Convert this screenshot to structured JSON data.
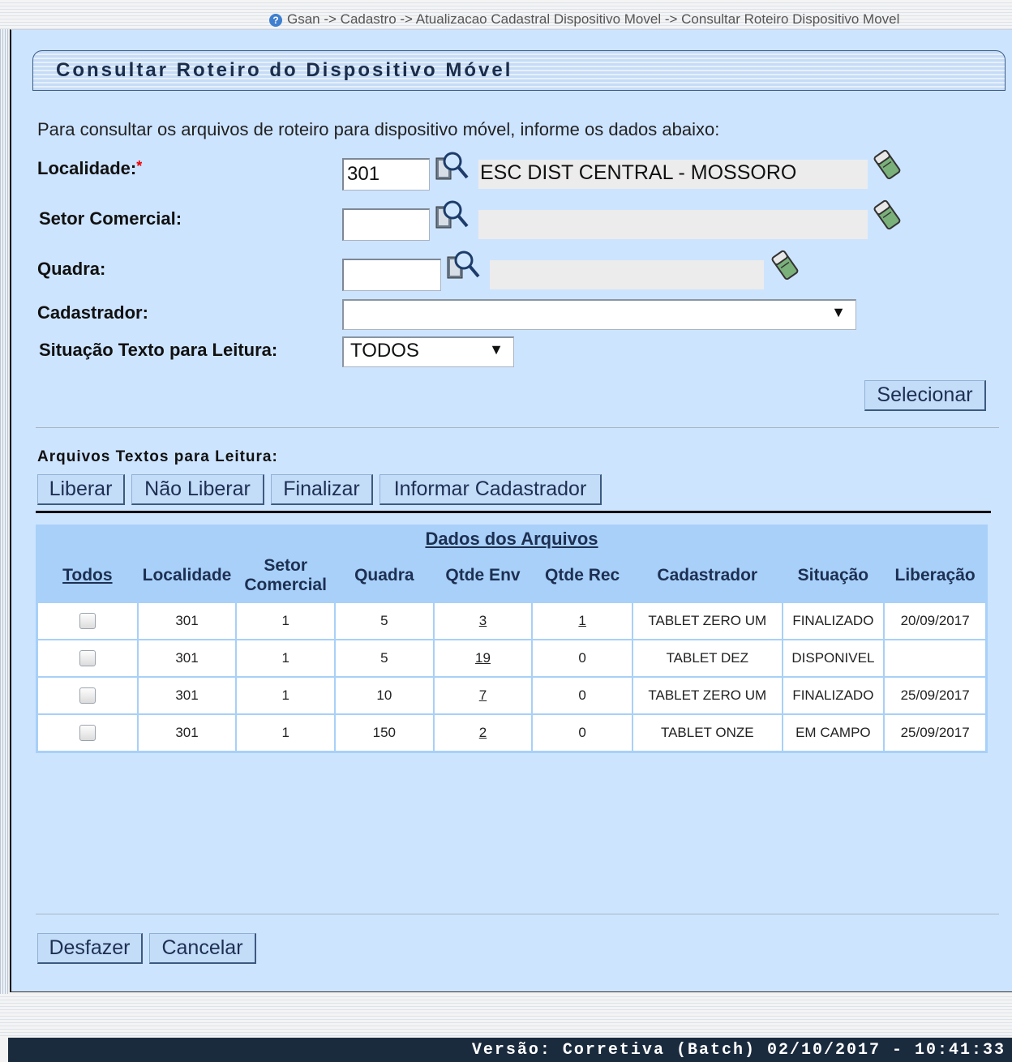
{
  "breadcrumb": "Gsan -> Cadastro -> Atualizacao Cadastral Dispositivo Movel -> Consultar Roteiro Dispositivo Movel",
  "page_title": "Consultar Roteiro do Dispositivo Móvel",
  "intro_text": "Para consultar os arquivos de roteiro para dispositivo móvel, informe os dados abaixo:",
  "form": {
    "localidade": {
      "label": "Localidade:",
      "required_mark": "*",
      "code": "301",
      "description": "ESC DIST CENTRAL - MOSSORO"
    },
    "setor_comercial": {
      "label": "Setor Comercial:",
      "code": "",
      "description": ""
    },
    "quadra": {
      "label": "Quadra:",
      "code": "",
      "description": ""
    },
    "cadastrador": {
      "label": "Cadastrador:",
      "selected": ""
    },
    "situacao": {
      "label": "Situação Texto para Leitura:",
      "selected": "TODOS"
    },
    "selecionar_label": "Selecionar"
  },
  "arquivos": {
    "section_label": "Arquivos Textos para Leitura:",
    "actions": {
      "liberar": "Liberar",
      "nao_liberar": "Não Liberar",
      "finalizar": "Finalizar",
      "informar": "Informar Cadastrador"
    },
    "table_title": "Dados dos Arquivos",
    "headers": {
      "todos": "Todos",
      "localidade": "Localidade",
      "setor": "Setor Comercial",
      "quadra": "Quadra",
      "qtde_env": "Qtde Env",
      "qtde_rec": "Qtde Rec",
      "cadastrador": "Cadastrador",
      "situacao": "Situação",
      "liberacao": "Liberação"
    },
    "rows": [
      {
        "checked": false,
        "localidade": "301",
        "setor": "1",
        "quadra": "5",
        "qtde_env": "3",
        "qtde_rec": "1",
        "qtde_rec_link": true,
        "cadastrador": "TABLET ZERO UM",
        "situacao": "FINALIZADO",
        "liberacao": "20/09/2017"
      },
      {
        "checked": false,
        "localidade": "301",
        "setor": "1",
        "quadra": "5",
        "qtde_env": "19",
        "qtde_rec": "0",
        "qtde_rec_link": false,
        "cadastrador": "TABLET DEZ",
        "situacao": "DISPONIVEL",
        "liberacao": ""
      },
      {
        "checked": false,
        "localidade": "301",
        "setor": "1",
        "quadra": "10",
        "qtde_env": "7",
        "qtde_rec": "0",
        "qtde_rec_link": false,
        "cadastrador": "TABLET ZERO UM",
        "situacao": "FINALIZADO",
        "liberacao": "25/09/2017"
      },
      {
        "checked": false,
        "localidade": "301",
        "setor": "1",
        "quadra": "150",
        "qtde_env": "2",
        "qtde_rec": "0",
        "qtde_rec_link": false,
        "cadastrador": "TABLET ONZE",
        "situacao": "EM CAMPO",
        "liberacao": "25/09/2017"
      }
    ]
  },
  "bottom_buttons": {
    "desfazer": "Desfazer",
    "cancelar": "Cancelar"
  },
  "footer": "Versão: Corretiva (Batch) 02/10/2017 - 10:41:33",
  "icons": {
    "help": "help-icon",
    "search": "magnifier-icon",
    "clear": "eraser-icon",
    "dropdown": "triangle-down-icon"
  },
  "colors": {
    "panel_bg": "#cde4ff",
    "table_header_bg": "#a8d0f8",
    "button_bg": "#c3dcf8",
    "footer_bg": "#1b2b3e",
    "required": "#e00000"
  }
}
